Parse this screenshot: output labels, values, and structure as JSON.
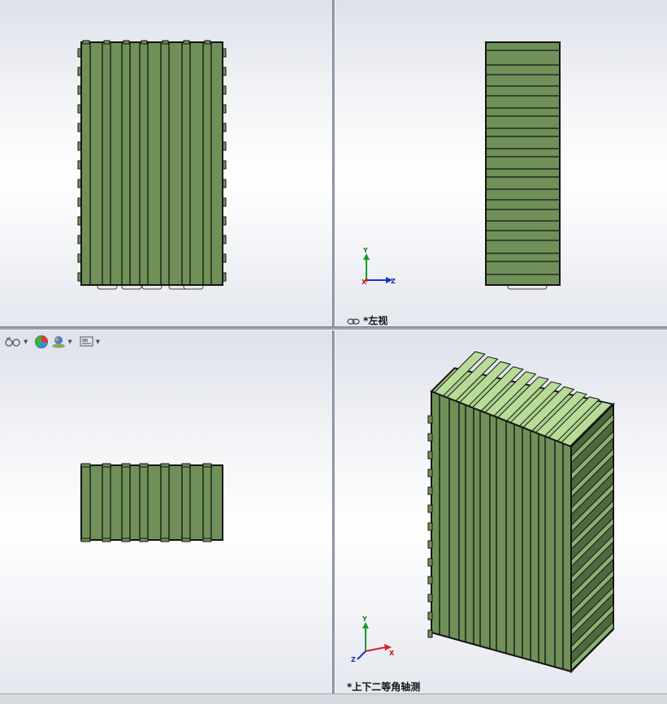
{
  "viewports": {
    "top_left": {
      "label": ""
    },
    "top_right": {
      "label": "*左视"
    },
    "bottom_left": {
      "label": ""
    },
    "bottom_right": {
      "label": "*上下二等角轴测"
    }
  },
  "hud_toolbar": {
    "items": [
      {
        "icon": "view-orientation-icon"
      },
      {
        "icon": "appearance-icon"
      },
      {
        "icon": "scene-icon"
      },
      {
        "icon": "display-style-icon"
      }
    ]
  },
  "triad": {
    "left_view": {
      "x": "Z",
      "y": "Y",
      "origin": "X"
    },
    "iso_view": {
      "x": "X",
      "y": "Y",
      "z": "Z"
    }
  },
  "colors": {
    "part_face": "#6f9058",
    "part_top": "#a9d08a",
    "part_side": "#4e6840",
    "edge": "#141414",
    "triad_x": "#d82020",
    "triad_y": "#1a9a2a",
    "triad_z": "#2030d0"
  }
}
